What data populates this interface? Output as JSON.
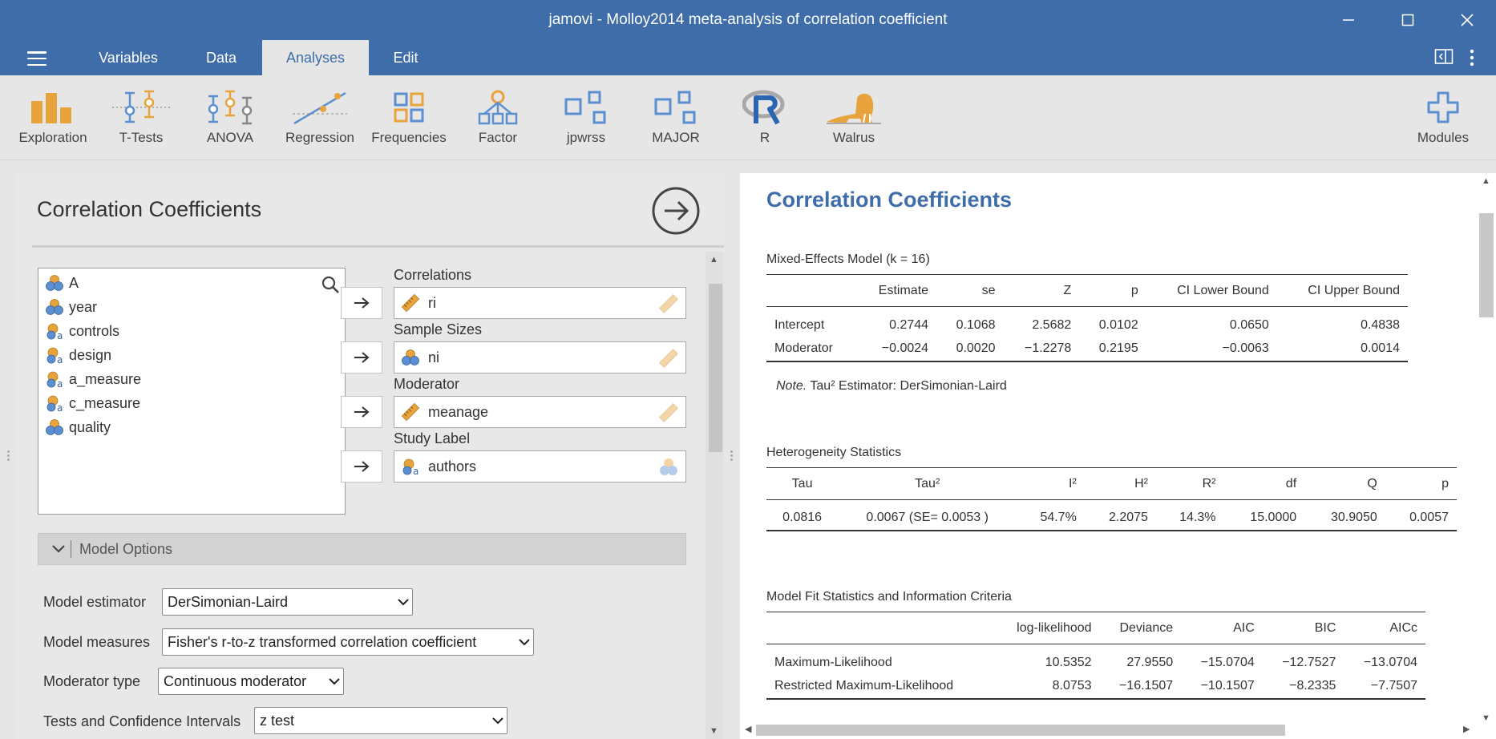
{
  "window": {
    "title": "jamovi - Molloy2014 meta-analysis of correlation coefficient"
  },
  "menu": {
    "tabs": [
      "Variables",
      "Data",
      "Analyses",
      "Edit"
    ],
    "active": "Analyses"
  },
  "ribbon": {
    "items": [
      "Exploration",
      "T-Tests",
      "ANOVA",
      "Regression",
      "Frequencies",
      "Factor",
      "jpwrss",
      "MAJOR",
      "R",
      "Walrus"
    ],
    "modules": "Modules"
  },
  "colors": {
    "brand": "#3e6da9",
    "icon_orange": "#e8a33c",
    "icon_blue": "#5b8fd0"
  },
  "options": {
    "title": "Correlation Coefficients",
    "variables": [
      {
        "name": "A",
        "type": "nominal"
      },
      {
        "name": "year",
        "type": "nominal"
      },
      {
        "name": "controls",
        "type": "nominal-text"
      },
      {
        "name": "design",
        "type": "nominal-text"
      },
      {
        "name": "a_measure",
        "type": "nominal-text"
      },
      {
        "name": "c_measure",
        "type": "nominal-text"
      },
      {
        "name": "quality",
        "type": "nominal"
      }
    ],
    "targets": [
      {
        "label": "Correlations",
        "value": "ri"
      },
      {
        "label": "Sample Sizes",
        "value": "ni"
      },
      {
        "label": "Moderator",
        "value": "meanage"
      },
      {
        "label": "Study Label",
        "value": "authors"
      }
    ],
    "model_options": "Model Options",
    "model_estimator": {
      "label": "Model estimator",
      "value": "DerSimonian-Laird"
    },
    "model_measures": {
      "label": "Model measures",
      "value": "Fisher's r-to-z transformed correlation coefficient"
    },
    "moderator_type": {
      "label": "Moderator type",
      "value": "Continuous moderator"
    },
    "tests_ci": {
      "label": "Tests and Confidence Intervals",
      "value": "z test"
    }
  },
  "results": {
    "title": "Correlation Coefficients",
    "mixed": {
      "caption": "Mixed-Effects Model (k = 16)",
      "headers": [
        "",
        "Estimate",
        "se",
        "Z",
        "p",
        "CI Lower Bound",
        "CI Upper Bound"
      ],
      "rows": [
        [
          "Intercept",
          "0.2744",
          "0.1068",
          "2.5682",
          "0.0102",
          "0.0650",
          "0.4838"
        ],
        [
          "Moderator",
          "−0.0024",
          "0.0020",
          "−1.2278",
          "0.2195",
          "−0.0063",
          "0.0014"
        ]
      ],
      "note_label": "Note.",
      "note_text": "Tau² Estimator: DerSimonian-Laird"
    },
    "hetero": {
      "caption": "Heterogeneity Statistics",
      "headers": [
        "Tau",
        "Tau²",
        "I²",
        "H²",
        "R²",
        "df",
        "Q",
        "p"
      ],
      "row": [
        "0.0816",
        "0.0067 (SE= 0.0053 )",
        "54.7%",
        "2.2075",
        "14.3%",
        "15.0000",
        "30.9050",
        "0.0057"
      ]
    },
    "fit": {
      "caption": "Model Fit Statistics and Information Criteria",
      "headers": [
        "",
        "log-likelihood",
        "Deviance",
        "AIC",
        "BIC",
        "AICc"
      ],
      "rows": [
        [
          "Maximum-Likelihood",
          "10.5352",
          "27.9550",
          "−15.0704",
          "−12.7527",
          "−13.0704"
        ],
        [
          "Restricted Maximum-Likelihood",
          "8.0753",
          "−16.1507",
          "−10.1507",
          "−8.2335",
          "−7.7507"
        ]
      ]
    }
  }
}
